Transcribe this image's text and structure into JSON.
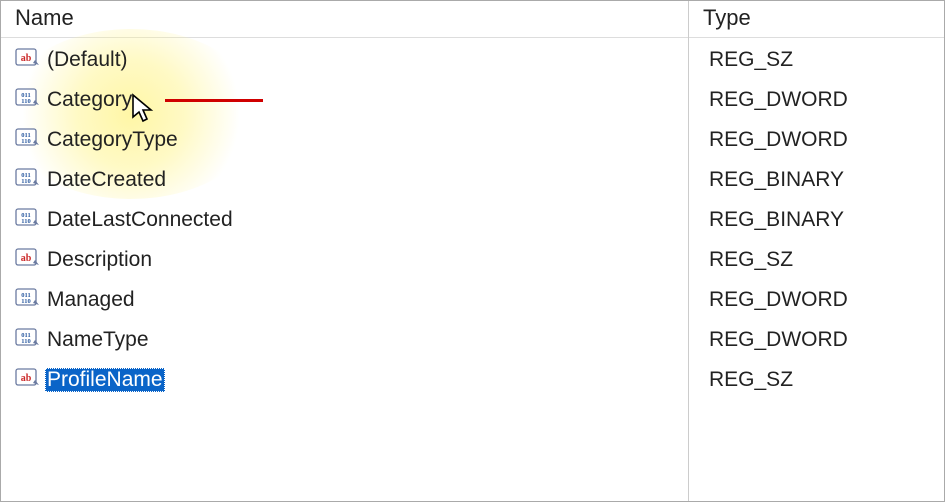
{
  "columns": {
    "name": "Name",
    "type": "Type"
  },
  "values": [
    {
      "name": "(Default)",
      "type": "REG_SZ",
      "icon": "string"
    },
    {
      "name": "Category",
      "type": "REG_DWORD",
      "icon": "binary"
    },
    {
      "name": "CategoryType",
      "type": "REG_DWORD",
      "icon": "binary"
    },
    {
      "name": "DateCreated",
      "type": "REG_BINARY",
      "icon": "binary"
    },
    {
      "name": "DateLastConnected",
      "type": "REG_BINARY",
      "icon": "binary"
    },
    {
      "name": "Description",
      "type": "REG_SZ",
      "icon": "string"
    },
    {
      "name": "Managed",
      "type": "REG_DWORD",
      "icon": "binary"
    },
    {
      "name": "NameType",
      "type": "REG_DWORD",
      "icon": "binary"
    },
    {
      "name": "ProfileName",
      "type": "REG_SZ",
      "icon": "string",
      "selected": true
    }
  ]
}
